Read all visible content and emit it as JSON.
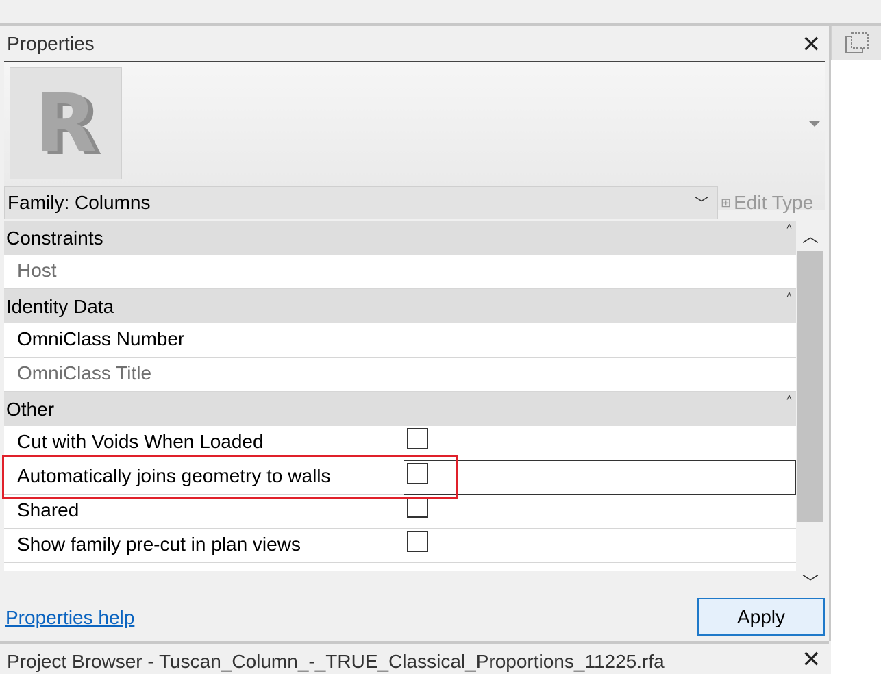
{
  "properties_panel": {
    "title": "Properties",
    "family_selector": "Family: Columns",
    "edit_type": "Edit Type",
    "groups": [
      {
        "label": "Constraints",
        "rows": [
          {
            "name": "Host",
            "dim": true
          }
        ]
      },
      {
        "label": "Identity Data",
        "rows": [
          {
            "name": "OmniClass Number",
            "dim": false
          },
          {
            "name": "OmniClass Title",
            "dim": true
          }
        ]
      },
      {
        "label": "Other",
        "rows": [
          {
            "name": "Cut with Voids When Loaded",
            "checked": false
          },
          {
            "name": "Automatically joins geometry to walls",
            "checked": false,
            "selected": true
          },
          {
            "name": "Shared",
            "checked": false
          },
          {
            "name": "Show family pre-cut in plan views",
            "checked": false
          }
        ]
      }
    ],
    "help_link": "Properties help",
    "apply_button": "Apply"
  },
  "project_browser": {
    "title": "Project Browser - Tuscan_Column_-_TRUE_Classical_Proportions_11225.rfa"
  },
  "colors": {
    "highlight": "#e0202a",
    "link": "#0b64c0",
    "apply_border": "#1f79c9"
  },
  "icons": {
    "close": "close-icon",
    "thumbnail": "revit-logo",
    "collapse": "collapse-group-icon",
    "scroll_up": "chevron-up-icon",
    "scroll_down": "chevron-down-icon"
  }
}
